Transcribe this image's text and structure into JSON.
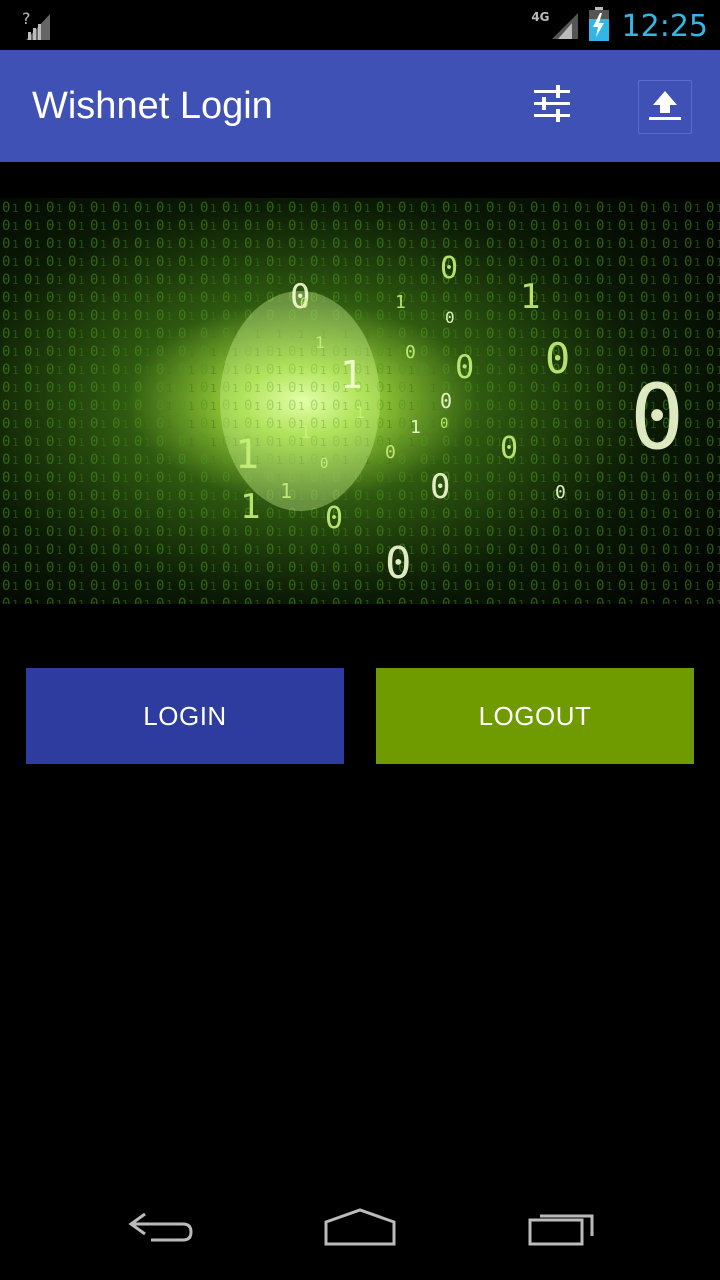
{
  "status_bar": {
    "no_sim_icon": "signal-unknown-icon",
    "network_label": "4G",
    "time": "12:25",
    "accent": "#33b5e5"
  },
  "app_bar": {
    "title": "Wishnet Login",
    "color": "#3f51b5",
    "actions": [
      {
        "icon": "tune-sliders-icon"
      },
      {
        "icon": "upload-icon"
      }
    ]
  },
  "hero": {
    "description_icon": "binary-tunnel-image",
    "digits": [
      "0",
      "0",
      "1",
      "1",
      "0",
      "0",
      "0",
      "1",
      "0",
      "0",
      "1",
      "0",
      "0",
      "1",
      "0",
      "0",
      "1",
      "0",
      "1",
      "0",
      "1",
      "0",
      "1",
      "0",
      "0",
      "0",
      "1"
    ]
  },
  "buttons": {
    "login": {
      "label": "LOGIN",
      "color": "#2e3b9f"
    },
    "logout": {
      "label": "LOGOUT",
      "color": "#6f9a00"
    }
  },
  "nav_bar": {
    "back": "back-icon",
    "home": "home-icon",
    "recent": "recent-apps-icon"
  }
}
